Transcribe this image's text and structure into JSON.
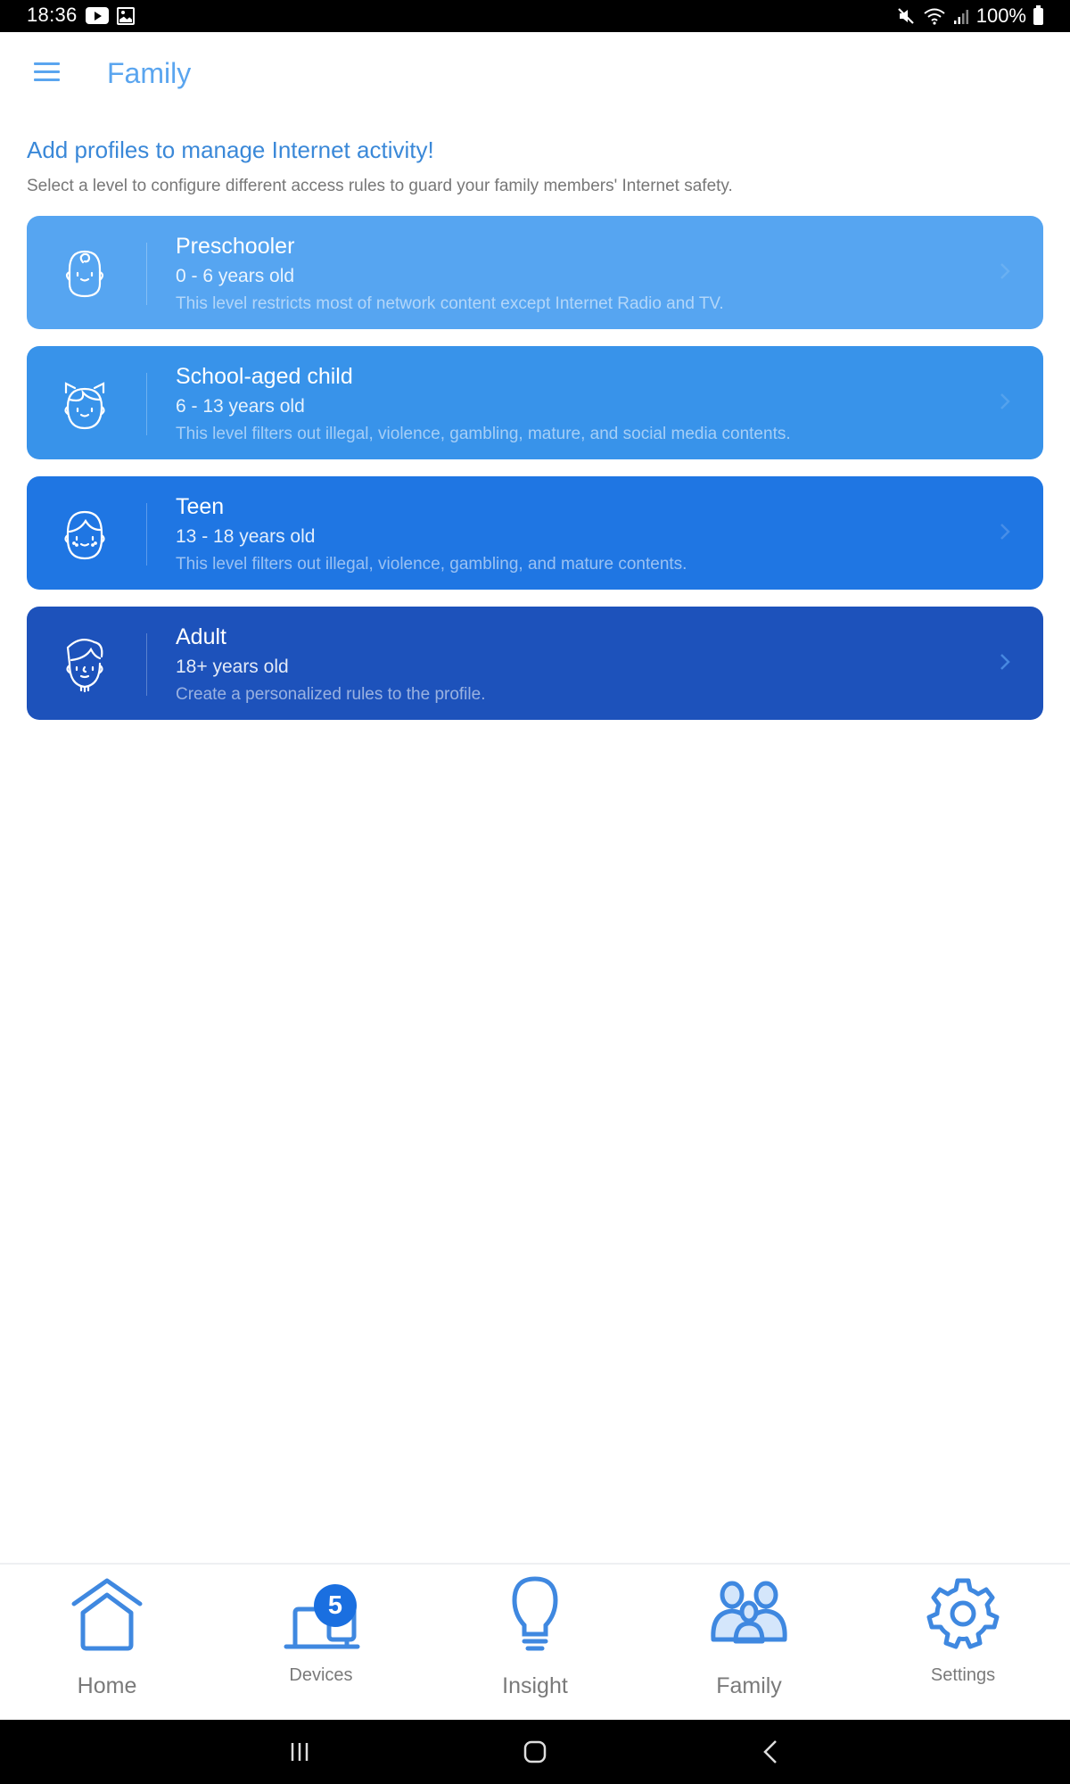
{
  "status_bar": {
    "time": "18:36",
    "left_icons": [
      "youtube-icon",
      "gallery-icon"
    ],
    "right_icons": [
      "mute-icon",
      "wifi-icon",
      "signal-icon",
      "battery-icon"
    ],
    "battery": "100%"
  },
  "header": {
    "menu_icon": "hamburger-menu-icon",
    "title": "Family"
  },
  "intro": {
    "heading": "Add profiles to manage Internet activity!",
    "text": "Select a level to configure different access rules to guard your family members' Internet safety."
  },
  "profiles": [
    {
      "title": "Preschooler",
      "age": "0 - 6 years old",
      "description": "This level restricts most of network content except Internet Radio and TV.",
      "icon": "baby-face-icon",
      "color": "#56a5f1"
    },
    {
      "title": "School-aged child",
      "age": "6 - 13 years old",
      "description": "This level filters out illegal, violence, gambling, mature, and social media contents.",
      "icon": "child-face-icon",
      "color": "#3893ea"
    },
    {
      "title": "Teen",
      "age": "13 - 18 years old",
      "description": "This level filters out illegal, violence, gambling, and mature contents.",
      "icon": "teen-face-icon",
      "color": "#1f76e3"
    },
    {
      "title": "Adult",
      "age": "18+ years old",
      "description": "Create a personalized rules to the profile.",
      "icon": "adult-face-icon",
      "color": "#1d52bb"
    }
  ],
  "bottom_nav": {
    "items": [
      {
        "label": "Home",
        "icon": "home-icon"
      },
      {
        "label": "Devices",
        "icon": "devices-icon",
        "badge": "5"
      },
      {
        "label": "Insight",
        "icon": "lightbulb-icon"
      },
      {
        "label": "Family",
        "icon": "family-icon",
        "active": true
      },
      {
        "label": "Settings",
        "icon": "gear-icon"
      }
    ]
  },
  "system_nav": [
    "recent-apps-icon",
    "home-circle-icon",
    "back-icon"
  ],
  "colors": {
    "accent": "#5aa5ef",
    "icon_blue": "#3f88e0",
    "badge": "#1a6fe0"
  }
}
